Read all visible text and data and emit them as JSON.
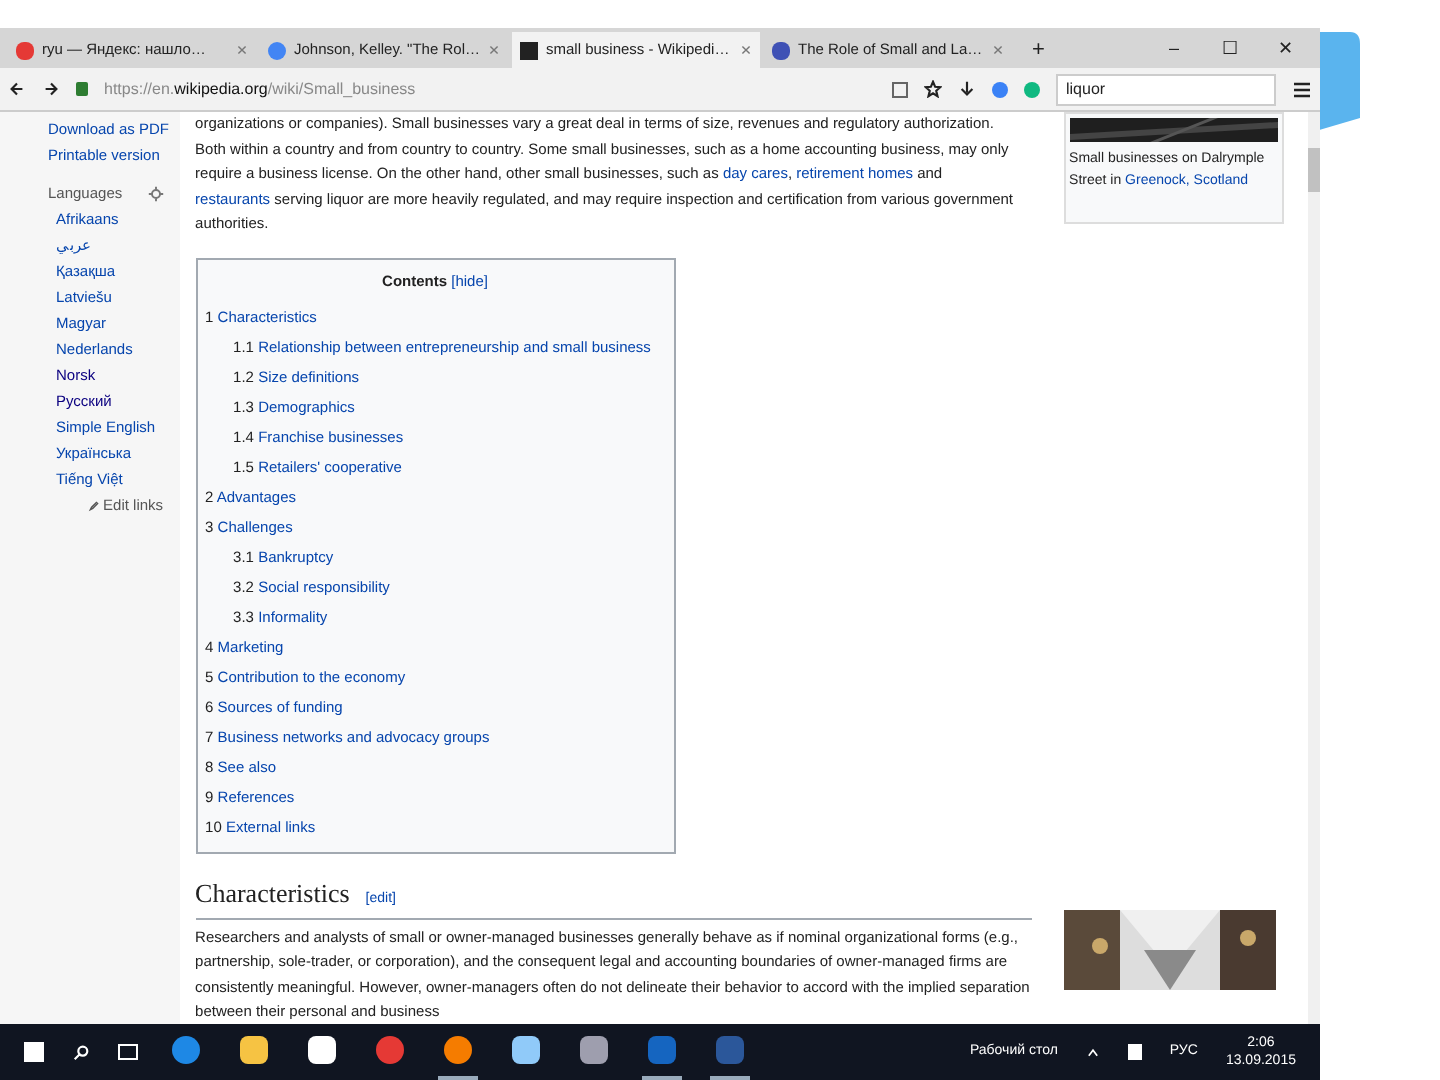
{
  "browser": {
    "tabs": [
      {
        "title": "ryu — Яндекс: нашло…",
        "kind": "yandex",
        "selected": false
      },
      {
        "title": "Johnson, Kelley. \"The Rol…",
        "kind": "g",
        "selected": false
      },
      {
        "title": "small business - Wikipedi…",
        "kind": "w",
        "selected": true
      },
      {
        "title": "The Role of Small and La…",
        "kind": "doc",
        "selected": false
      }
    ],
    "new_tab": "+",
    "window_controls": [
      "–",
      "☐",
      "✕"
    ],
    "address": {
      "host_prefix": "https://en.",
      "host": "wikipedia.org",
      "path": "/wiki/Small_business"
    },
    "search": {
      "value": "liquor"
    }
  },
  "sidebar": {
    "items": [
      {
        "label": "Download as PDF",
        "kind": "link"
      },
      {
        "label": "Printable version",
        "kind": "link"
      }
    ],
    "languages_heading": "Languages",
    "languages": [
      {
        "label": "Afrikaans",
        "visited": false
      },
      {
        "label": "عربي",
        "visited": false
      },
      {
        "label": "Қазақша",
        "visited": false
      },
      {
        "label": "Latviešu",
        "visited": false
      },
      {
        "label": "Magyar",
        "visited": false
      },
      {
        "label": "Nederlands",
        "visited": false
      },
      {
        "label": "Norsk",
        "visited": true
      },
      {
        "label": "Русский",
        "visited": true
      },
      {
        "label": "Simple English",
        "visited": false
      },
      {
        "label": "Українська",
        "visited": false
      },
      {
        "label": "Tiếng Việt",
        "visited": false
      }
    ],
    "edit_links": "Edit links"
  },
  "article": {
    "intro": [
      {
        "text": "organizations or companies). Small businesses vary a great deal in terms of size, revenues and regulatory authorization. Both within a country and from country to country. Some small businesses, such as a home accounting business, may only require a business license. On the other hand, other small businesses, such as ",
        "link": false
      },
      {
        "text": "day cares",
        "link": true
      },
      {
        "text": ", ",
        "link": false
      },
      {
        "text": "retirement homes",
        "link": true
      },
      {
        "text": " and ",
        "link": false
      },
      {
        "text": "restaurants",
        "link": true
      },
      {
        "text": " serving liquor are more heavily regulated, and may require inspection and certification from various government authorities.",
        "link": false
      }
    ],
    "figure": {
      "caption_start": "Small businesses on Dalrymple Street in ",
      "caption_link": "Greenock, Scotland"
    },
    "toc": {
      "title": "Contents",
      "toggle": "[hide]",
      "items": [
        {
          "number": "1",
          "label": "Characteristics",
          "children": [
            {
              "number": "1.1",
              "label": "Relationship between entrepreneurship and small business"
            },
            {
              "number": "1.2",
              "label": "Size definitions"
            },
            {
              "number": "1.3",
              "label": "Demographics"
            },
            {
              "number": "1.4",
              "label": "Franchise businesses"
            },
            {
              "number": "1.5",
              "label": "Retailers' cooperative"
            }
          ]
        },
        {
          "number": "2",
          "label": "Advantages"
        },
        {
          "number": "3",
          "label": "Challenges",
          "children": [
            {
              "number": "3.1",
              "label": "Bankruptcy"
            },
            {
              "number": "3.2",
              "label": "Social responsibility"
            },
            {
              "number": "3.3",
              "label": "Informality"
            }
          ]
        },
        {
          "number": "4",
          "label": "Marketing"
        },
        {
          "number": "5",
          "label": "Contribution to the economy"
        },
        {
          "number": "6",
          "label": "Sources of funding"
        },
        {
          "number": "7",
          "label": "Business networks and advocacy groups"
        },
        {
          "number": "8",
          "label": "See also"
        },
        {
          "number": "9",
          "label": "References"
        },
        {
          "number": "10",
          "label": "External links"
        }
      ]
    },
    "section": {
      "heading": "Characteristics",
      "edit": "[edit]",
      "paragraph": "Researchers and analysts of small or owner-managed businesses generally behave as if nominal organizational forms (e.g., partnership, sole-trader, or corporation), and the consequent legal and accounting boundaries of owner-managed firms are consistently meaningful. However, owner-managers often do not delineate their behavior to accord with the implied separation between their personal and business"
    }
  },
  "taskbar": {
    "apps": [
      {
        "kind": "edge",
        "active": false
      },
      {
        "kind": "explorer",
        "active": false
      },
      {
        "kind": "store",
        "active": false
      },
      {
        "kind": "opera",
        "active": false
      },
      {
        "kind": "firefox",
        "active": true
      },
      {
        "kind": "app",
        "active": false
      },
      {
        "kind": "app2",
        "active": false
      },
      {
        "kind": "g",
        "active": true
      },
      {
        "kind": "word",
        "active": true
      }
    ],
    "desktop": "Рабочий стол",
    "language": "РУС",
    "time": "2:06",
    "date": "13.09.2015"
  }
}
